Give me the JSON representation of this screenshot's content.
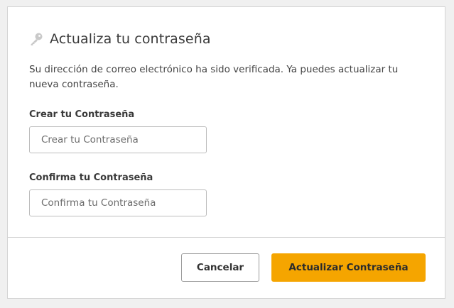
{
  "dialog": {
    "title": "Actualiza tu contraseña",
    "title_icon": "key-icon",
    "description": "Su dirección de correo electrónico ha sido verificada. Ya puedes actualizar tu nueva contraseña."
  },
  "fields": {
    "create": {
      "label": "Crear tu Contraseña",
      "placeholder": "Crear tu Contraseña",
      "value": ""
    },
    "confirm": {
      "label": "Confirma tu Contraseña",
      "placeholder": "Confirma tu Contraseña",
      "value": ""
    }
  },
  "actions": {
    "cancel_label": "Cancelar",
    "submit_label": "Actualizar Contraseña"
  },
  "colors": {
    "primary": "#f5a500",
    "key_icon": "#c9c9c9",
    "border": "#d4d4d4"
  }
}
